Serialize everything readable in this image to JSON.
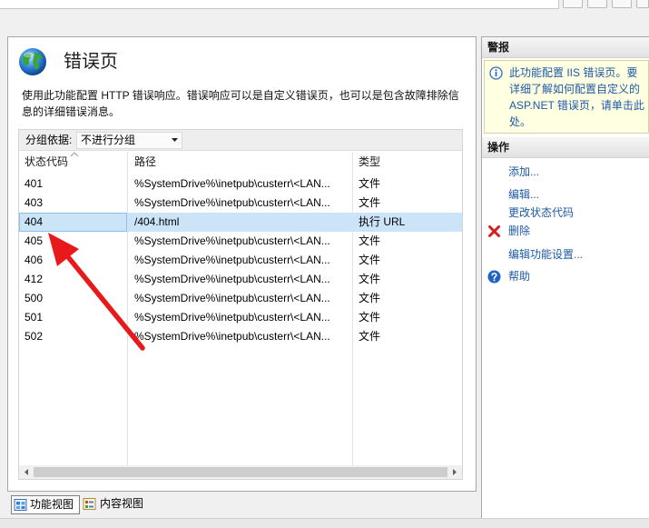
{
  "page": {
    "title": "错误页",
    "description_lines": [
      "使用此功能配置 HTTP 错误响应。错误响应可以是自定义错误页，也可以是包含故障排除信",
      "息的详细错误消息。"
    ]
  },
  "group_by": {
    "label": "分组依据:",
    "value": "不进行分组"
  },
  "table": {
    "columns": {
      "code": {
        "label": "状态代码",
        "sort_ascending": true
      },
      "path": {
        "label": "路径"
      },
      "type": {
        "label": "类型"
      }
    },
    "rows": [
      {
        "code": "401",
        "path": "%SystemDrive%\\inetpub\\custerr\\<LAN...",
        "type": "文件"
      },
      {
        "code": "403",
        "path": "%SystemDrive%\\inetpub\\custerr\\<LAN...",
        "type": "文件"
      },
      {
        "code": "404",
        "path": "/404.html",
        "type": "执行 URL",
        "selected": true
      },
      {
        "code": "405",
        "path": "%SystemDrive%\\inetpub\\custerr\\<LAN...",
        "type": "文件"
      },
      {
        "code": "406",
        "path": "%SystemDrive%\\inetpub\\custerr\\<LAN...",
        "type": "文件"
      },
      {
        "code": "412",
        "path": "%SystemDrive%\\inetpub\\custerr\\<LAN...",
        "type": "文件"
      },
      {
        "code": "500",
        "path": "%SystemDrive%\\inetpub\\custerr\\<LAN...",
        "type": "文件"
      },
      {
        "code": "501",
        "path": "%SystemDrive%\\inetpub\\custerr\\<LAN...",
        "type": "文件"
      },
      {
        "code": "502",
        "path": "%SystemDrive%\\inetpub\\custerr\\<LAN...",
        "type": "文件"
      }
    ]
  },
  "view_tabs": [
    {
      "label": "功能视图",
      "icon": "features-view-icon",
      "selected": true
    },
    {
      "label": "内容视图",
      "icon": "content-view-icon",
      "selected": false
    }
  ],
  "alerts": {
    "header": "警报",
    "icon": "info-icon",
    "lines": [
      "此功能配置 IIS 错误页。要",
      "详细了解如何配置自定义的",
      "ASP.NET 错误页，请单击此",
      "处。"
    ]
  },
  "actions": {
    "header": "操作",
    "items": [
      {
        "label": "添加..."
      },
      {
        "label": "编辑..."
      },
      {
        "label": "更改状态代码"
      },
      {
        "label": "删除",
        "icon": "delete-icon"
      },
      {
        "label": "编辑功能设置..."
      },
      {
        "label": "帮助",
        "icon": "help-icon"
      }
    ]
  },
  "colors": {
    "link": "#1e5aa8",
    "selection": "#cce4f7",
    "alert_background": "#ffffe1",
    "annotation_arrow": "#e8191b"
  }
}
